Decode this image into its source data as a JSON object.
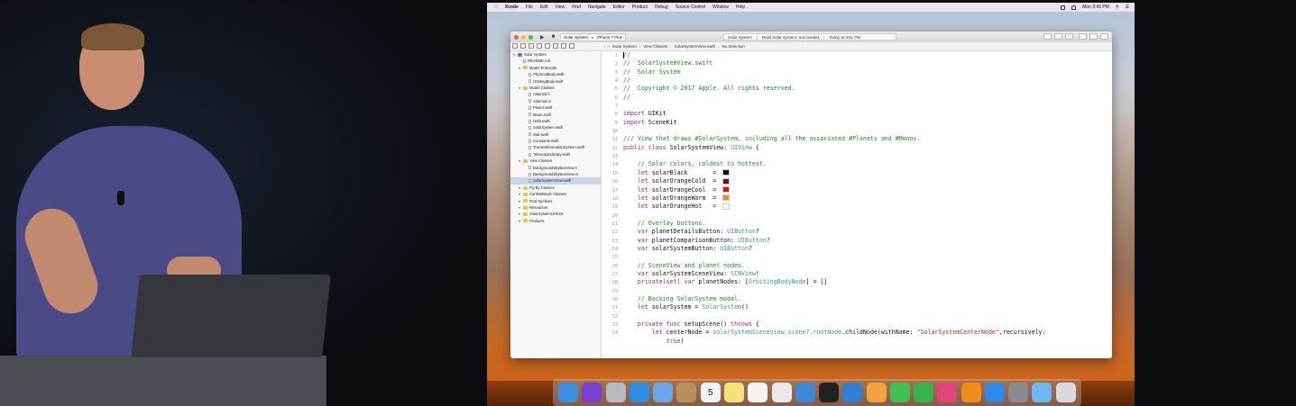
{
  "menubar": {
    "apple_icon": "apple-icon",
    "items": [
      "Xcode",
      "File",
      "Edit",
      "View",
      "Find",
      "Navigate",
      "Editor",
      "Product",
      "Debug",
      "Source Control",
      "Window",
      "Help"
    ],
    "clock": "Mon 3:43 PM"
  },
  "toolbar": {
    "scheme": "Solar System",
    "device": "iPhone 7 Plus",
    "status_project": "Solar System",
    "status_message": "Build Solar System: Succeeded",
    "status_time": "Today at 3:51 PM"
  },
  "jumpbar": {
    "crumbs": [
      "Solar System",
      "View Classes",
      "SolarSystemView.swift",
      "No Selection"
    ]
  },
  "navigator": {
    "rows": [
      {
        "label": "Solar System",
        "kind": "project",
        "indent": 0
      },
      {
        "label": "README.md",
        "kind": "file",
        "indent": 1
      },
      {
        "label": "Model Protocols",
        "kind": "folder",
        "indent": 1
      },
      {
        "label": "PhysicalBody.swift",
        "kind": "file",
        "indent": 2
      },
      {
        "label": "OrbitingBody.swift",
        "kind": "file",
        "indent": 2
      },
      {
        "label": "Model Classes",
        "kind": "folder",
        "indent": 1
      },
      {
        "label": "Asteroid.h",
        "kind": "file",
        "indent": 2
      },
      {
        "label": "Asteroid.m",
        "kind": "file",
        "indent": 2
      },
      {
        "label": "Planet.swift",
        "kind": "file",
        "indent": 2
      },
      {
        "label": "Moon.swift",
        "kind": "file",
        "indent": 2
      },
      {
        "label": "Orbit.swift",
        "kind": "file",
        "indent": 2
      },
      {
        "label": "SolarSystem.swift",
        "kind": "file",
        "indent": 2
      },
      {
        "label": "Star.swift",
        "kind": "file",
        "indent": 2
      },
      {
        "label": "Constants.swift",
        "kind": "file",
        "indent": 2
      },
      {
        "label": "TransitInformationSystem.swift",
        "kind": "file",
        "indent": 2
      },
      {
        "label": "TelescopeLibrary.swift",
        "kind": "file",
        "indent": 2
      },
      {
        "label": "View Classes",
        "kind": "folder",
        "indent": 1
      },
      {
        "label": "BackgroundSkyBoxView.h",
        "kind": "file",
        "indent": 2
      },
      {
        "label": "BackgroundSkyBoxView.m",
        "kind": "file",
        "indent": 2
      },
      {
        "label": "SolarSystemView.swift",
        "kind": "file",
        "indent": 2,
        "selected": true
      },
      {
        "label": "Fly By Classes",
        "kind": "folder",
        "indent": 1
      },
      {
        "label": "ConfettiMode Classes",
        "kind": "folder",
        "indent": 1
      },
      {
        "label": "Find Symbols",
        "kind": "folder",
        "indent": 1
      },
      {
        "label": "Resources",
        "kind": "folder",
        "indent": 1
      },
      {
        "label": "SolarSystemUITests",
        "kind": "folder",
        "indent": 1
      },
      {
        "label": "Products",
        "kind": "folder",
        "indent": 1
      }
    ]
  },
  "code": {
    "lines": [
      {
        "n": "1",
        "segs": [
          {
            "t": "//",
            "c": "cmt"
          }
        ]
      },
      {
        "n": "2",
        "segs": [
          {
            "t": "//  SolarSystemView.swift",
            "c": "cmt"
          }
        ]
      },
      {
        "n": "3",
        "segs": [
          {
            "t": "//  Solar System",
            "c": "cmt"
          }
        ]
      },
      {
        "n": "4",
        "segs": [
          {
            "t": "//",
            "c": "cmt"
          }
        ]
      },
      {
        "n": "5",
        "segs": [
          {
            "t": "//  Copyright © 2017 Apple. All rights reserved.",
            "c": "cmt"
          }
        ]
      },
      {
        "n": "6",
        "segs": [
          {
            "t": "//",
            "c": "cmt"
          }
        ]
      },
      {
        "n": "7",
        "segs": []
      },
      {
        "n": "8",
        "segs": [
          {
            "t": "import",
            "c": "kw"
          },
          {
            "t": " UIKit",
            "c": ""
          }
        ]
      },
      {
        "n": "9",
        "segs": [
          {
            "t": "import",
            "c": "kw"
          },
          {
            "t": " SceneKit",
            "c": ""
          }
        ]
      },
      {
        "n": "10",
        "segs": []
      },
      {
        "n": "11",
        "segs": [
          {
            "t": "/// View that draws #SolarSystem, including all the associated #Planets and #Moons.",
            "c": "cmt"
          }
        ]
      },
      {
        "n": "12",
        "segs": [
          {
            "t": "public class",
            "c": "kw"
          },
          {
            "t": " SolarSystemView: ",
            "c": ""
          },
          {
            "t": "UIView",
            "c": "ty"
          },
          {
            "t": " {",
            "c": ""
          }
        ]
      },
      {
        "n": "13",
        "segs": []
      },
      {
        "n": "14",
        "segs": [
          {
            "t": "    // Solar colors, coldest to hottest.",
            "c": "cmt"
          }
        ]
      },
      {
        "n": "15",
        "segs": [
          {
            "t": "    ",
            "c": ""
          },
          {
            "t": "let",
            "c": "kw"
          },
          {
            "t": " solarBlack       = ",
            "c": ""
          }
        ],
        "swatch": "#1c0b06"
      },
      {
        "n": "16",
        "segs": [
          {
            "t": "    ",
            "c": ""
          },
          {
            "t": "let",
            "c": "kw"
          },
          {
            "t": " solarOrangeCold  = ",
            "c": ""
          }
        ],
        "swatch": "#7a0d0f"
      },
      {
        "n": "17",
        "segs": [
          {
            "t": "    ",
            "c": ""
          },
          {
            "t": "let",
            "c": "kw"
          },
          {
            "t": " solarOrangeCool  = ",
            "c": ""
          }
        ],
        "swatch": "#c51b10"
      },
      {
        "n": "18",
        "segs": [
          {
            "t": "    ",
            "c": ""
          },
          {
            "t": "let",
            "c": "kw"
          },
          {
            "t": " solarOrangeWarm  = ",
            "c": ""
          }
        ],
        "swatch": "#f08a18"
      },
      {
        "n": "19",
        "segs": [
          {
            "t": "    ",
            "c": ""
          },
          {
            "t": "let",
            "c": "kw"
          },
          {
            "t": " solarOrangeHot   = ",
            "c": ""
          }
        ],
        "swatch": "#fff4e6"
      },
      {
        "n": "20",
        "segs": []
      },
      {
        "n": "21",
        "segs": [
          {
            "t": "    // Overlay buttons.",
            "c": "cmt"
          }
        ]
      },
      {
        "n": "22",
        "segs": [
          {
            "t": "    ",
            "c": ""
          },
          {
            "t": "var",
            "c": "kw"
          },
          {
            "t": " planetDetailsButton: ",
            "c": ""
          },
          {
            "t": "UIButton",
            "c": "ty"
          },
          {
            "t": "?",
            "c": ""
          }
        ]
      },
      {
        "n": "23",
        "segs": [
          {
            "t": "    ",
            "c": ""
          },
          {
            "t": "var",
            "c": "kw"
          },
          {
            "t": " planetComparisonButton: ",
            "c": ""
          },
          {
            "t": "UIButton",
            "c": "ty"
          },
          {
            "t": "?",
            "c": ""
          }
        ]
      },
      {
        "n": "24",
        "segs": [
          {
            "t": "    ",
            "c": ""
          },
          {
            "t": "var",
            "c": "kw"
          },
          {
            "t": " solarSystemButton: ",
            "c": ""
          },
          {
            "t": "UIButton",
            "c": "ty"
          },
          {
            "t": "?",
            "c": ""
          }
        ]
      },
      {
        "n": "25",
        "segs": []
      },
      {
        "n": "26",
        "segs": [
          {
            "t": "    // SceneView and planet nodes.",
            "c": "cmt"
          }
        ]
      },
      {
        "n": "27",
        "segs": [
          {
            "t": "    ",
            "c": ""
          },
          {
            "t": "var",
            "c": "kw"
          },
          {
            "t": " solarSystemSceneView: ",
            "c": ""
          },
          {
            "t": "SCNView",
            "c": "ty"
          },
          {
            "t": "!",
            "c": ""
          }
        ]
      },
      {
        "n": "28",
        "segs": [
          {
            "t": "    ",
            "c": ""
          },
          {
            "t": "private(set) var",
            "c": "kw"
          },
          {
            "t": " planetNodes: [",
            "c": ""
          },
          {
            "t": "OrbitingBodyNode",
            "c": "ty"
          },
          {
            "t": "] = []",
            "c": ""
          }
        ]
      },
      {
        "n": "29",
        "segs": []
      },
      {
        "n": "30",
        "segs": [
          {
            "t": "    // Backing SolarSystem model.",
            "c": "cmt"
          }
        ]
      },
      {
        "n": "31",
        "segs": [
          {
            "t": "    ",
            "c": ""
          },
          {
            "t": "let",
            "c": "kw"
          },
          {
            "t": " solarSystem = ",
            "c": ""
          },
          {
            "t": "SolarSystem",
            "c": "ty"
          },
          {
            "t": "()",
            "c": ""
          }
        ]
      },
      {
        "n": "32",
        "segs": []
      },
      {
        "n": "33",
        "segs": [
          {
            "t": "    ",
            "c": ""
          },
          {
            "t": "private func",
            "c": "kw"
          },
          {
            "t": " setupScene() ",
            "c": ""
          },
          {
            "t": "throws",
            "c": "kw"
          },
          {
            "t": " {",
            "c": ""
          }
        ]
      },
      {
        "n": "34",
        "segs": [
          {
            "t": "        ",
            "c": ""
          },
          {
            "t": "let",
            "c": "kw"
          },
          {
            "t": " centerNode = ",
            "c": ""
          },
          {
            "t": "solarSystemSceneView.scene?.rootNode",
            "c": "ty"
          },
          {
            "t": ".childNode(withName: ",
            "c": ""
          },
          {
            "t": "\"SolarSystemCenterNode\"",
            "c": "str"
          },
          {
            "t": ",recursively:",
            "c": ""
          }
        ]
      },
      {
        "n": "",
        "segs": [
          {
            "t": "            ",
            "c": ""
          },
          {
            "t": "true",
            "c": "kw"
          },
          {
            "t": ")",
            "c": ""
          }
        ]
      }
    ]
  },
  "dock": {
    "icons": [
      {
        "name": "finder-icon",
        "color": "#3d8fe0"
      },
      {
        "name": "siri-icon",
        "color": "#7a3fd0"
      },
      {
        "name": "launchpad-icon",
        "color": "#b8b8c0"
      },
      {
        "name": "safari-icon",
        "color": "#2f8ee6"
      },
      {
        "name": "mail-icon",
        "color": "#6ba7e8"
      },
      {
        "name": "contacts-icon",
        "color": "#b8915a"
      },
      {
        "name": "calendar-icon",
        "color": "#f3f3f3"
      },
      {
        "name": "notes-icon",
        "color": "#f5e27c"
      },
      {
        "name": "reminders-icon",
        "color": "#f4f4f4"
      },
      {
        "name": "preview-icon",
        "color": "#e8e8e8"
      },
      {
        "name": "xcode-icon",
        "color": "#3b8ad8"
      },
      {
        "name": "terminal-icon",
        "color": "#222222"
      },
      {
        "name": "folder-icon",
        "color": "#2f7fd4"
      },
      {
        "name": "photos-icon",
        "color": "#f2a23c"
      },
      {
        "name": "messages-icon",
        "color": "#3fbf56"
      },
      {
        "name": "facetime-icon",
        "color": "#38b24b"
      },
      {
        "name": "itunes-icon",
        "color": "#e2447a"
      },
      {
        "name": "ibooks-icon",
        "color": "#f08b1d"
      },
      {
        "name": "app-store-icon",
        "color": "#2d8ae6"
      },
      {
        "name": "system-preferences-icon",
        "color": "#8a8a8f"
      },
      {
        "name": "downloads-folder-icon",
        "color": "#6fb5ee"
      },
      {
        "name": "trash-icon",
        "color": "#d9d9dc"
      }
    ],
    "calendar_day": "5"
  },
  "colors": {
    "selection": "#c9d6ea",
    "comment": "#1f8a1f",
    "keyword": "#a3228e",
    "type": "#3c8ea0",
    "string": "#c8241d"
  }
}
